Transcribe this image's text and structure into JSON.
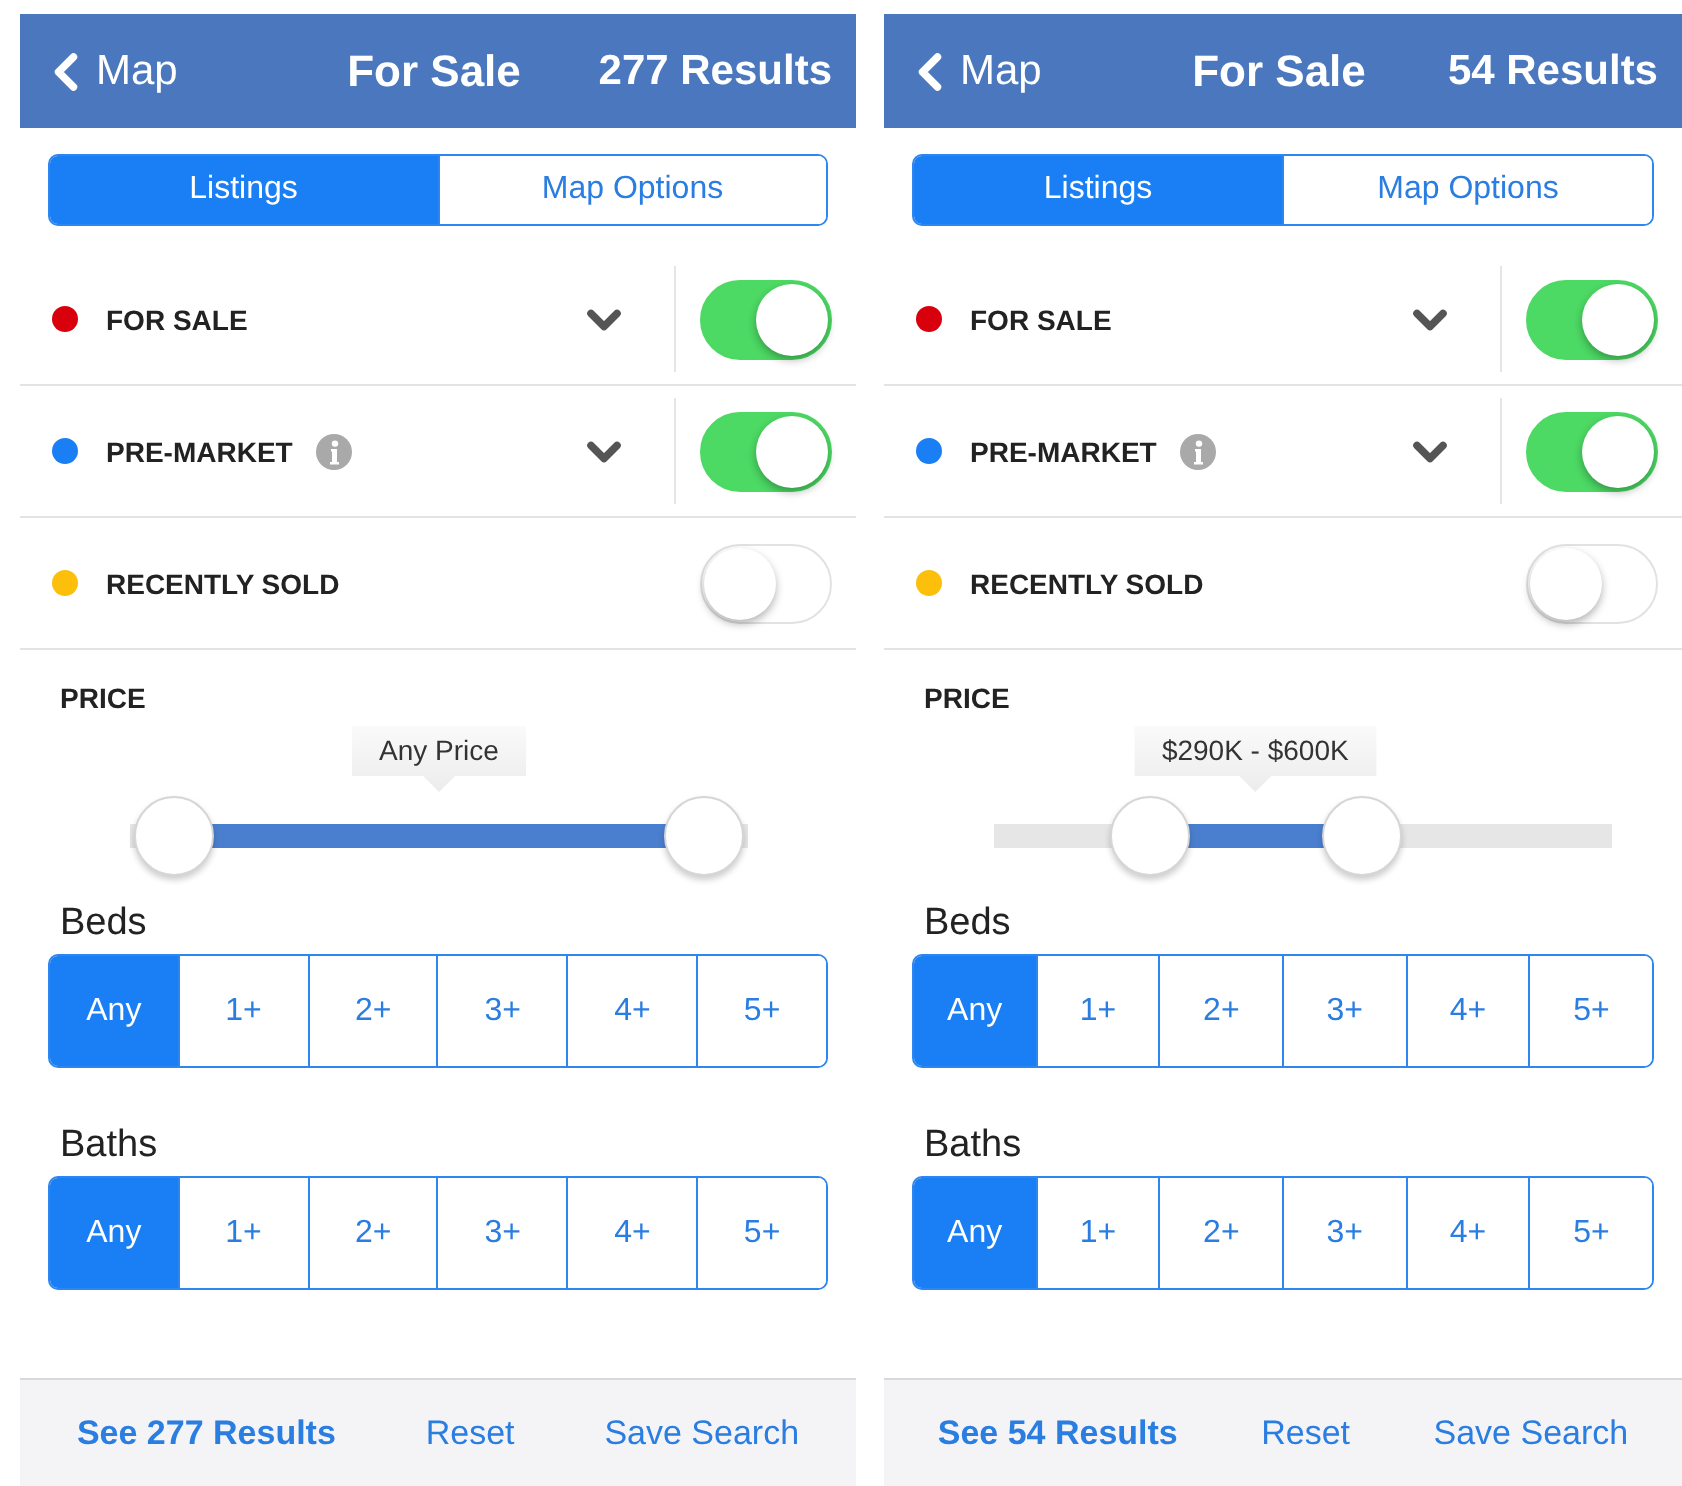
{
  "screens": [
    {
      "header": {
        "back": "Map",
        "title": "For Sale",
        "results": "277 Results"
      },
      "tabs": [
        {
          "label": "Listings",
          "selected": true
        },
        {
          "label": "Map Options",
          "selected": false
        }
      ],
      "filters": [
        {
          "label": "FOR SALE",
          "color": "#d9000d",
          "info": false,
          "expandable": true,
          "on": true
        },
        {
          "label": "PRE-MARKET",
          "color": "#1a7ff5",
          "info": true,
          "expandable": true,
          "on": true
        },
        {
          "label": "RECENTLY SOLD",
          "color": "#fbbf0c",
          "info": false,
          "expandable": false,
          "on": false
        }
      ],
      "price": {
        "label": "PRICE",
        "tooltip": "Any Price",
        "thumbs": [
          {
            "level": 0
          },
          {
            "level": 1
          }
        ]
      },
      "beds": {
        "label": "Beds",
        "options": [
          {
            "label": "Any",
            "selected": true
          },
          {
            "label": "1+",
            "selected": false
          },
          {
            "label": "2+",
            "selected": false
          },
          {
            "label": "3+",
            "selected": false
          },
          {
            "label": "4+",
            "selected": false
          },
          {
            "label": "5+",
            "selected": false
          }
        ]
      },
      "baths": {
        "label": "Baths",
        "options": [
          {
            "label": "Any",
            "selected": true
          },
          {
            "label": "1+",
            "selected": false
          },
          {
            "label": "2+",
            "selected": false
          },
          {
            "label": "3+",
            "selected": false
          },
          {
            "label": "4+",
            "selected": false
          },
          {
            "label": "5+",
            "selected": false
          }
        ]
      },
      "footer": {
        "results": "See 277 Results",
        "reset": "Reset",
        "save": "Save Search"
      }
    },
    {
      "header": {
        "back": "Map",
        "title": "For Sale",
        "results": "54 Results"
      },
      "tabs": [
        {
          "label": "Listings",
          "selected": true
        },
        {
          "label": "Map Options",
          "selected": false
        }
      ],
      "filters": [
        {
          "label": "FOR SALE",
          "color": "#d9000d",
          "info": false,
          "expandable": true,
          "on": true
        },
        {
          "label": "PRE-MARKET",
          "color": "#1a7ff5",
          "info": true,
          "expandable": true,
          "on": true
        },
        {
          "label": "RECENTLY SOLD",
          "color": "#fbbf0c",
          "info": false,
          "expandable": false,
          "on": false
        }
      ],
      "price": {
        "label": "PRICE",
        "tooltip": "$290K - $600K",
        "thumbs": [
          {
            "level": 0.21
          },
          {
            "level": 0.61
          }
        ]
      },
      "beds": {
        "label": "Beds",
        "options": [
          {
            "label": "Any",
            "selected": true
          },
          {
            "label": "1+",
            "selected": false
          },
          {
            "label": "2+",
            "selected": false
          },
          {
            "label": "3+",
            "selected": false
          },
          {
            "label": "4+",
            "selected": false
          },
          {
            "label": "5+",
            "selected": false
          }
        ]
      },
      "baths": {
        "label": "Baths",
        "options": [
          {
            "label": "Any",
            "selected": true
          },
          {
            "label": "1+",
            "selected": false
          },
          {
            "label": "2+",
            "selected": false
          },
          {
            "label": "3+",
            "selected": false
          },
          {
            "label": "4+",
            "selected": false
          },
          {
            "label": "5+",
            "selected": false
          }
        ]
      },
      "footer": {
        "results": "See 54 Results",
        "reset": "Reset",
        "save": "Save Search"
      }
    }
  ]
}
